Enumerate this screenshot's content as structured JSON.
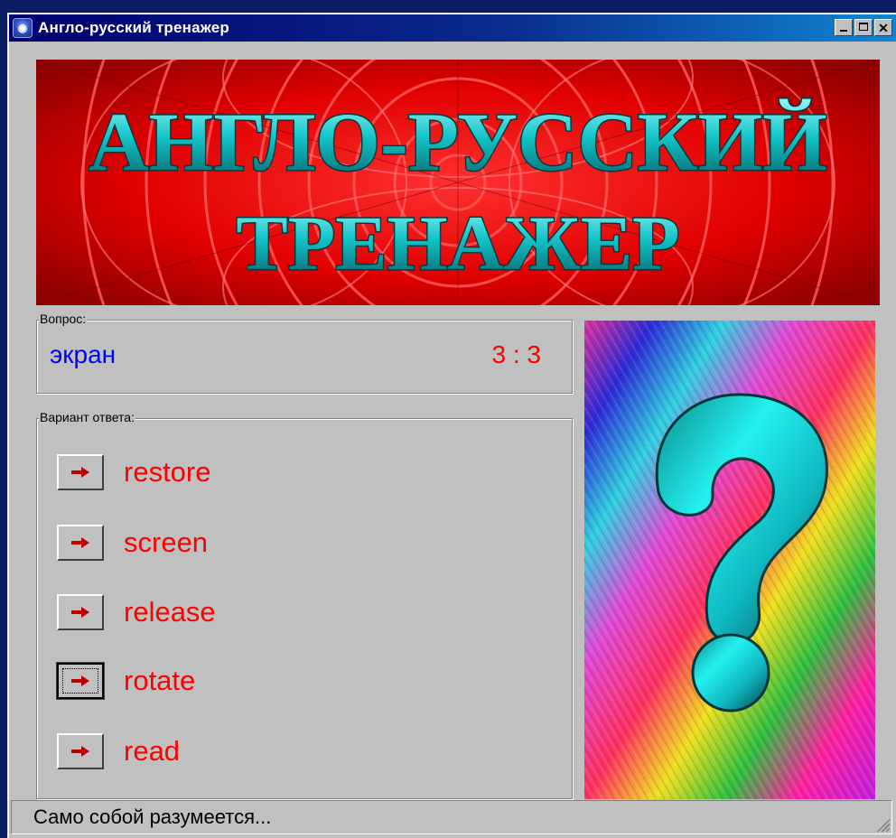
{
  "window": {
    "title": "Англо-русский тренажер",
    "icon": "app-globe-icon"
  },
  "banner": {
    "line1": "АНГЛО-РУССКИЙ",
    "line2": "ТРЕНАЖЕР"
  },
  "question": {
    "legend": "Вопрос:",
    "word": "экран",
    "score": "3 : 3"
  },
  "answers": {
    "legend": "Вариант ответа:",
    "items": [
      {
        "label": "restore"
      },
      {
        "label": "screen"
      },
      {
        "label": "release"
      },
      {
        "label": "rotate"
      },
      {
        "label": "read"
      }
    ]
  },
  "picture": {
    "icon": "question-mark-icon"
  },
  "status": {
    "text": "Само собой разумеется..."
  },
  "colors": {
    "title_bar": "#00006e",
    "banner_bg": "#ff1010",
    "banner_text": "#1fc8c8",
    "question_word": "#0000ff",
    "score": "#ff0000",
    "answer_text": "#ff0000"
  }
}
